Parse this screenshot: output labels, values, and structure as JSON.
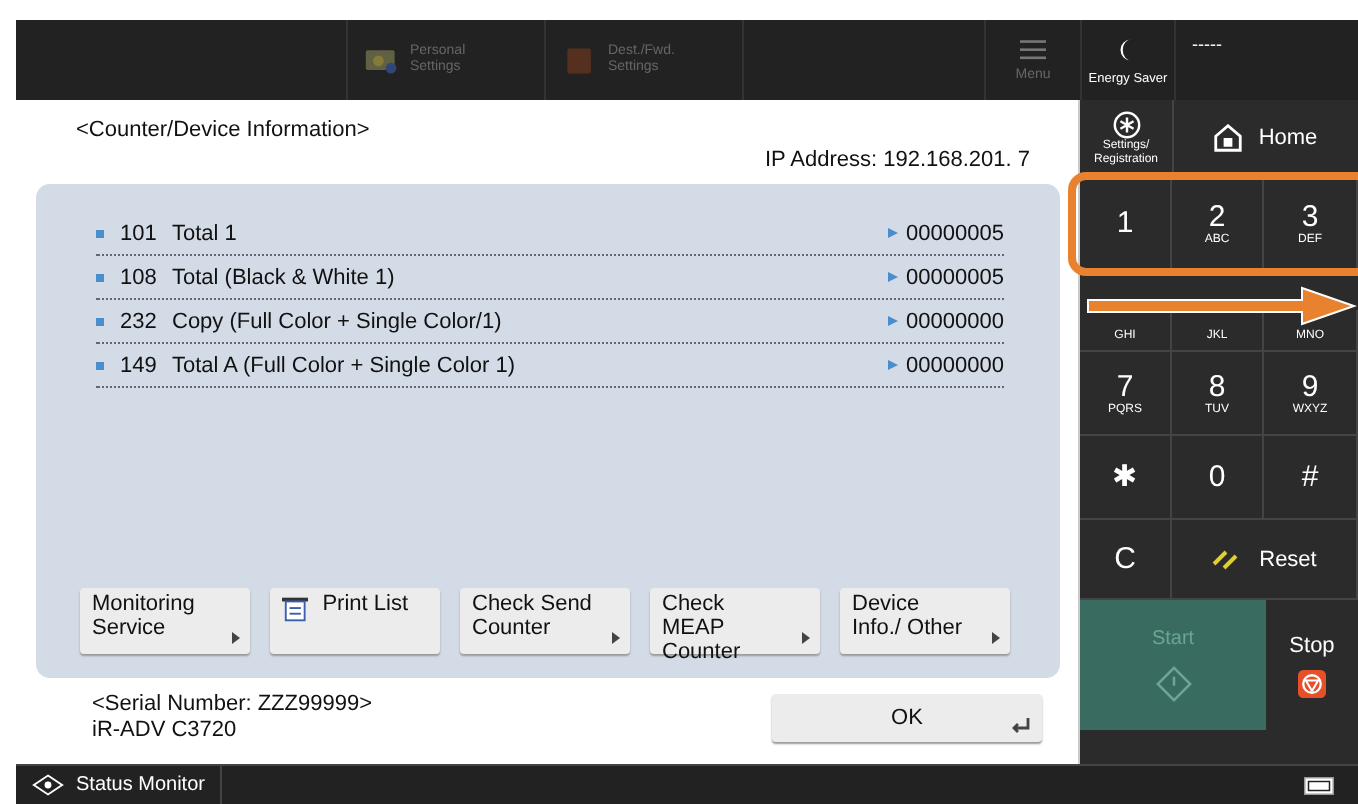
{
  "top_bar": {
    "items": [
      {
        "kind": "personal",
        "label": "Personal Settings"
      },
      {
        "kind": "dest",
        "label": "Dest./Fwd. Settings"
      }
    ],
    "menu": {
      "label": "Menu"
    },
    "energy_saver": {
      "label": "Energy Saver"
    },
    "status_text": "-----"
  },
  "screen": {
    "title": "<Counter/Device Information>",
    "ip_address": "IP Address: 192.168.201.  7",
    "counters": [
      {
        "code": "101",
        "name": "Total 1",
        "value": "00000005"
      },
      {
        "code": "108",
        "name": "Total (Black & White 1)",
        "value": "00000005"
      },
      {
        "code": "232",
        "name": "Copy (Full Color + Single Color/1)",
        "value": "00000000"
      },
      {
        "code": "149",
        "name": "Total A (Full Color + Single Color 1)",
        "value": "00000000"
      }
    ],
    "buttons": [
      {
        "kind": "submenu",
        "label": "Monitoring Service"
      },
      {
        "kind": "print",
        "label": "Print List"
      },
      {
        "kind": "submenu",
        "label": "Check Send Counter"
      },
      {
        "kind": "submenu",
        "label": "Check MEAP Counter"
      },
      {
        "kind": "submenu",
        "label": "Device Info./ Other"
      }
    ],
    "serial": "<Serial Number: ZZZ99999>",
    "model": "iR-ADV C3720",
    "ok": "OK"
  },
  "side": {
    "settings": "Settings/ Registration",
    "home": "Home",
    "keys": [
      {
        "digit": "1"
      },
      {
        "digit": "2",
        "letters": "ABC"
      },
      {
        "digit": "3",
        "letters": "DEF"
      },
      {
        "letters": "GHI"
      },
      {
        "letters": "JKL"
      },
      {
        "letters": "MNO"
      },
      {
        "digit": "7",
        "letters": "PQRS"
      },
      {
        "digit": "8",
        "letters": "TUV"
      },
      {
        "digit": "9",
        "letters": "WXYZ"
      },
      {
        "digit": "✱"
      },
      {
        "digit": "0"
      },
      {
        "digit": "#"
      }
    ],
    "clear": "C",
    "reset": "Reset",
    "start": {
      "label": "Start",
      "disabled": true
    },
    "stop": "Stop"
  },
  "status_bar": {
    "label": "Status Monitor"
  }
}
